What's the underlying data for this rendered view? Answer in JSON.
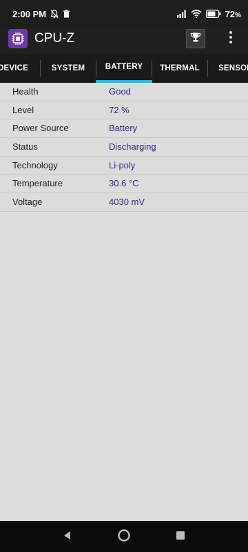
{
  "status_bar": {
    "time": "2:00 PM",
    "battery_percent": "72",
    "battery_suffix": "%"
  },
  "app": {
    "title": "CPU-Z"
  },
  "tabs": [
    {
      "label": "DEVICE",
      "active": false
    },
    {
      "label": "SYSTEM",
      "active": false
    },
    {
      "label": "BATTERY",
      "active": true
    },
    {
      "label": "THERMAL",
      "active": false
    },
    {
      "label": "SENSOR",
      "active": false
    }
  ],
  "battery_info": [
    {
      "label": "Health",
      "value": "Good"
    },
    {
      "label": "Level",
      "value": "72 %"
    },
    {
      "label": "Power Source",
      "value": "Battery"
    },
    {
      "label": "Status",
      "value": "Discharging"
    },
    {
      "label": "Technology",
      "value": "Li-poly"
    },
    {
      "label": "Temperature",
      "value": "30.6 °C"
    },
    {
      "label": "Voltage",
      "value": "4030 mV"
    }
  ],
  "colors": {
    "accent": "#3fa9e0",
    "value_text": "#2b2b8c",
    "logo_bg": "#6a3aa7"
  }
}
